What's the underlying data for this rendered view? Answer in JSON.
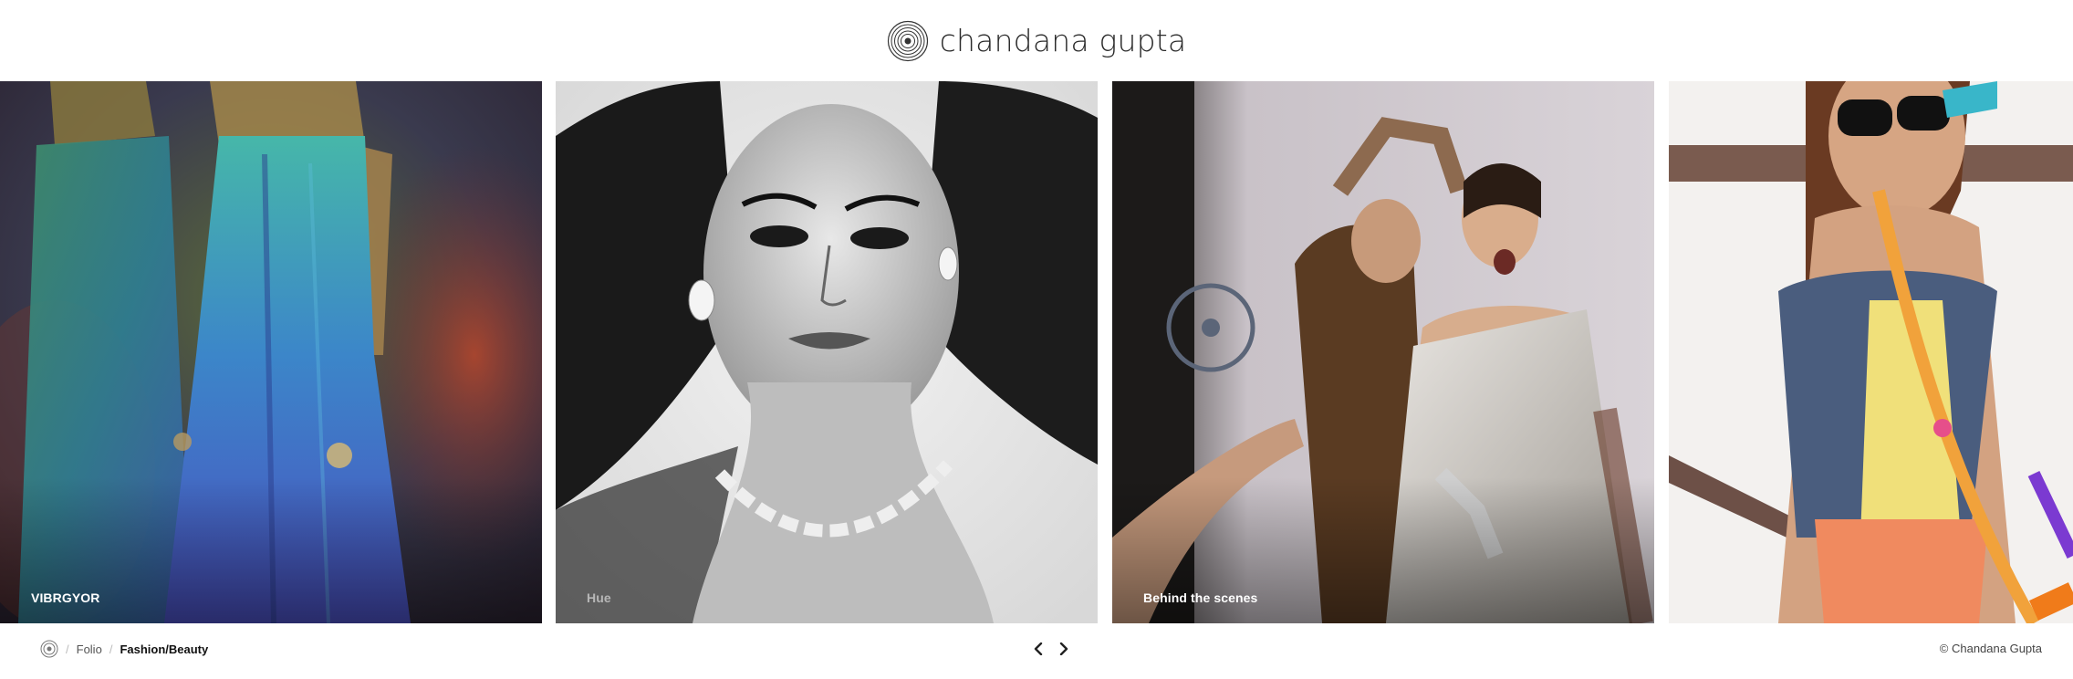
{
  "header": {
    "brand_name": "chandana gupta",
    "logo_icon": "concentric-circle-logo-icon"
  },
  "gallery": {
    "tiles": [
      {
        "caption": "VIBRGYOR",
        "subject": "two models in flowing blue-green gowns"
      },
      {
        "caption": "Hue",
        "subject": "black and white close-up portrait"
      },
      {
        "caption": "Behind the scenes",
        "subject": "stylist adjusting model's hair on set"
      },
      {
        "caption": "",
        "subject": "model in sunglasses with colorful accessories"
      }
    ]
  },
  "footer": {
    "breadcrumb": {
      "home_icon": "home-logo-icon",
      "separator": "/",
      "folio": "Folio",
      "current": "Fashion/Beauty"
    },
    "pager": {
      "prev_icon": "chevron-left-icon",
      "next_icon": "chevron-right-icon"
    },
    "copyright": "© Chandana Gupta"
  },
  "colors": {
    "background": "#ffffff",
    "text": "#222222",
    "caption": "#ffffff"
  }
}
